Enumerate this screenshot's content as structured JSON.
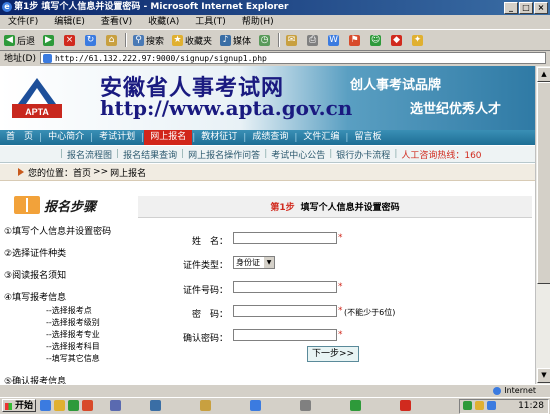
{
  "window": {
    "title": "第1步 填写个人信息并设置密码 - Microsoft Internet Explorer",
    "controls": [
      "_",
      "□",
      "×"
    ]
  },
  "menu": [
    "文件(F)",
    "编辑(E)",
    "查看(V)",
    "收藏(A)",
    "工具(T)",
    "帮助(H)"
  ],
  "toolbar": {
    "back": "后退",
    "search": "搜索",
    "favorites": "收藏夹",
    "media": "媒体"
  },
  "address": {
    "label": "地址(D)",
    "url": "http://61.132.222.97:9000/signup/signup1.php"
  },
  "site": {
    "title": "安徽省人事考试网",
    "url": "http://www.apta.gov.cn",
    "logo_text": "APTA",
    "slogan1": "创人事考试品牌",
    "slogan2": "选世纪优秀人才"
  },
  "nav": [
    "首　页",
    "中心简介",
    "考试计划",
    "网上报名",
    "教材征订",
    "成绩查询",
    "文件汇编",
    "留言板"
  ],
  "subnav": [
    "报名流程图",
    "报名结果查询",
    "网上报名操作问答",
    "考试中心公告",
    "银行办卡流程",
    "人工咨询热线：160"
  ],
  "location": {
    "label": "您的位置：",
    "home": "首页",
    "sep": ">>",
    "current": "网上报名"
  },
  "steps": {
    "title": "报名步骤",
    "items": [
      "①填写个人信息并设置密码",
      "②选择证件种类",
      "③阅读报名须知",
      "④填写报考信息",
      "⑤确认报考信息"
    ],
    "substeps": [
      "--选择报考点",
      "--选择报考级别",
      "--选择报考专业",
      "--选择报考科目",
      "--填写其它信息"
    ]
  },
  "form": {
    "step_no": "第1步",
    "heading": "填写个人信息并设置密码",
    "name_label": "姓　名：",
    "idtype_label": "证件类型：",
    "idtype_value": "身份证",
    "idno_label": "证件号码：",
    "pwd_label": "密　码：",
    "pwd_hint": "(不能少于6位)",
    "confirm_label": "确认密码：",
    "required_mark": "*",
    "next_button": "下一步>>"
  },
  "status": {
    "zone": "Internet"
  },
  "taskbar": {
    "start": "开始",
    "clock": "11:28"
  },
  "colors": {
    "title_bar": "#0a246a",
    "nav_bg": "#1d6e95",
    "nav_active": "#d1261a",
    "required": "#d12a1e"
  }
}
